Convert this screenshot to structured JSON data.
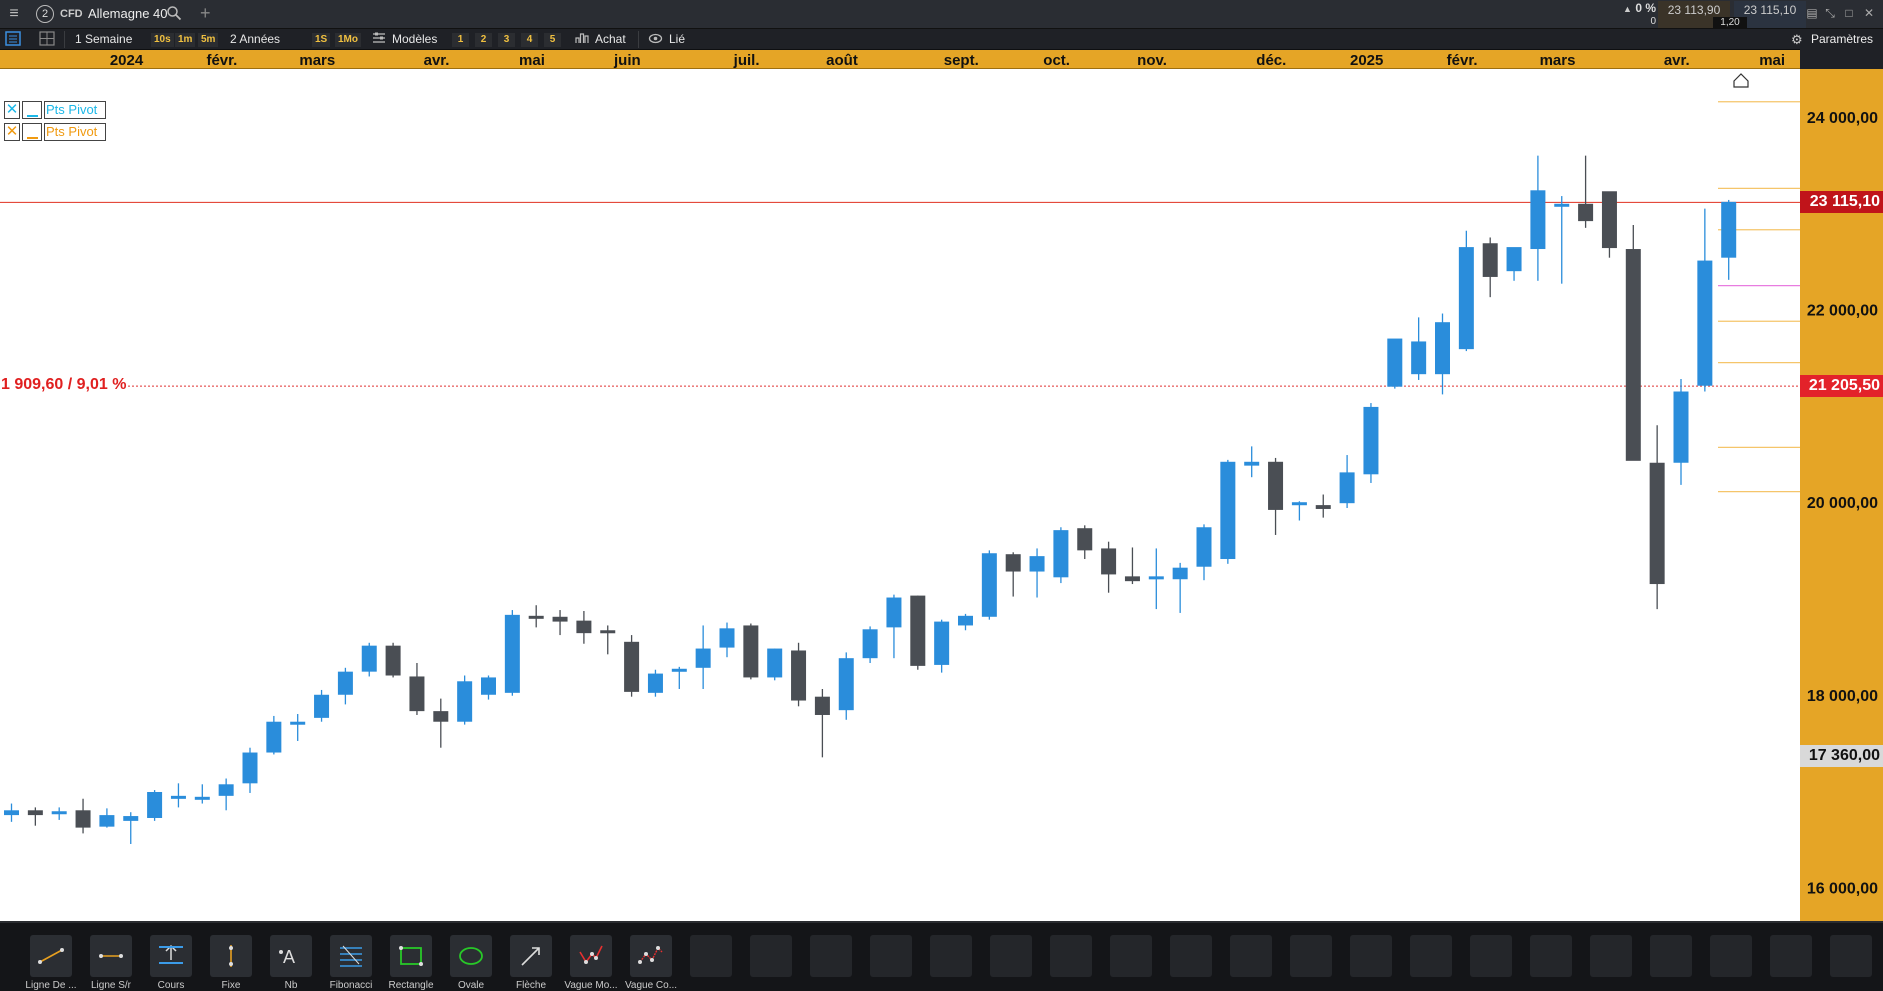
{
  "titlebar": {
    "instrument_number": "2",
    "type_badge": "CFD",
    "instrument": "Allemagne 40",
    "change_pct": "0 %",
    "change_abs": "0",
    "bid": "23 113,90",
    "ask": "23 115,10",
    "spread": "1,20"
  },
  "toolbar": {
    "period": "1 Semaine",
    "intervals": [
      "10s",
      "1m",
      "5m"
    ],
    "range": "2 Années",
    "ranges": [
      "1S",
      "1Mo"
    ],
    "templates": "Modèles",
    "presets": [
      "1",
      "2",
      "3",
      "4",
      "5"
    ],
    "buy": "Achat",
    "link": "Lié",
    "settings": "Paramètres"
  },
  "legend": [
    {
      "label": "Pts Pivot",
      "color": "#1cb8e8"
    },
    {
      "label": "Pts Pivot",
      "color": "#f09a10"
    }
  ],
  "measure_label": "1 909,60 / 9,01 %",
  "price_labels": {
    "current": "23 115,10",
    "reference": "21 205,50",
    "low": "17 360,00"
  },
  "colors": {
    "up": "#2a8ddb",
    "down": "#4a4e54",
    "time_axis": "#e5a526",
    "current_line": "#e03020",
    "pivot": "#f5c56a",
    "pivot_magenta": "#e87ce0"
  },
  "chart_data": {
    "type": "candlestick",
    "ylim": [
      15650,
      24500
    ],
    "y_ticks": [
      "16 000,00",
      "18 000,00",
      "20 000,00",
      "22 000,00",
      "24 000,00"
    ],
    "y_tick_values": [
      16000,
      18000,
      20000,
      22000,
      24000
    ],
    "x_ticks": [
      "2024",
      "févr.",
      "mars",
      "avr.",
      "mai",
      "juin",
      "juil.",
      "août",
      "sept.",
      "oct.",
      "nov.",
      "déc.",
      "2025",
      "févr.",
      "mars",
      "avr.",
      "mai"
    ],
    "x_tick_weeks": [
      0,
      4,
      8,
      13,
      17,
      21,
      26,
      30,
      35,
      39,
      43,
      48,
      52,
      56,
      60,
      65,
      69
    ],
    "current_price": 23115,
    "reference_price": 21205.5,
    "pivot_levels": [
      24160,
      23260,
      22830,
      21880,
      21450,
      20570,
      20110
    ],
    "candles": [
      [
        16750,
        16870,
        16680,
        16800
      ],
      [
        16800,
        16830,
        16640,
        16750
      ],
      [
        16760,
        16830,
        16700,
        16790
      ],
      [
        16800,
        16920,
        16560,
        16620
      ],
      [
        16630,
        16820,
        16620,
        16750
      ],
      [
        16690,
        16780,
        16450,
        16740
      ],
      [
        16720,
        17010,
        16690,
        16990
      ],
      [
        16920,
        17080,
        16830,
        16950
      ],
      [
        16920,
        17070,
        16870,
        16940
      ],
      [
        16950,
        17130,
        16800,
        17070
      ],
      [
        17080,
        17450,
        16980,
        17400
      ],
      [
        17400,
        17780,
        17380,
        17720
      ],
      [
        17700,
        17800,
        17520,
        17720
      ],
      [
        17760,
        18050,
        17720,
        18000
      ],
      [
        18000,
        18280,
        17900,
        18240
      ],
      [
        18240,
        18540,
        18190,
        18510
      ],
      [
        18510,
        18540,
        18180,
        18200
      ],
      [
        18190,
        18330,
        17790,
        17830
      ],
      [
        17830,
        17960,
        17450,
        17720
      ],
      [
        17720,
        18200,
        17690,
        18140
      ],
      [
        18000,
        18200,
        17950,
        18180
      ],
      [
        18020,
        18880,
        17990,
        18830
      ],
      [
        18820,
        18930,
        18700,
        18790
      ],
      [
        18810,
        18880,
        18620,
        18760
      ],
      [
        18770,
        18870,
        18530,
        18640
      ],
      [
        18670,
        18720,
        18420,
        18660
      ],
      [
        18550,
        18620,
        17980,
        18030
      ],
      [
        18020,
        18260,
        17980,
        18220
      ],
      [
        18240,
        18290,
        18060,
        18270
      ],
      [
        18280,
        18720,
        18060,
        18480
      ],
      [
        18490,
        18750,
        18390,
        18690
      ],
      [
        18720,
        18740,
        18160,
        18180
      ],
      [
        18180,
        18480,
        18150,
        18480
      ],
      [
        18460,
        18540,
        17880,
        17940
      ],
      [
        17980,
        18060,
        17350,
        17790
      ],
      [
        17840,
        18440,
        17740,
        18380
      ],
      [
        18380,
        18710,
        18330,
        18680
      ],
      [
        18700,
        19040,
        18380,
        19010
      ],
      [
        19030,
        19030,
        18260,
        18300
      ],
      [
        18310,
        18780,
        18230,
        18760
      ],
      [
        18720,
        18840,
        18670,
        18820
      ],
      [
        18810,
        19500,
        18780,
        19470
      ],
      [
        19460,
        19480,
        19020,
        19280
      ],
      [
        19280,
        19520,
        19010,
        19440
      ],
      [
        19220,
        19740,
        19160,
        19710
      ],
      [
        19730,
        19760,
        19410,
        19500
      ],
      [
        19520,
        19590,
        19060,
        19250
      ],
      [
        19230,
        19530,
        19150,
        19180
      ],
      [
        19200,
        19520,
        18890,
        19230
      ],
      [
        19200,
        19370,
        18850,
        19320
      ],
      [
        19330,
        19770,
        19190,
        19740
      ],
      [
        19410,
        20440,
        19360,
        20420
      ],
      [
        20380,
        20580,
        20260,
        20420
      ],
      [
        20420,
        20460,
        19660,
        19920
      ],
      [
        19970,
        20010,
        19810,
        20000
      ],
      [
        19970,
        20080,
        19840,
        19930
      ],
      [
        19990,
        20490,
        19940,
        20310
      ],
      [
        20290,
        21030,
        20200,
        20990
      ],
      [
        21200,
        21360,
        21180,
        21700
      ],
      [
        21330,
        21920,
        21270,
        21670
      ],
      [
        21330,
        21960,
        21120,
        21870
      ],
      [
        21590,
        22820,
        21570,
        22650
      ],
      [
        22690,
        22750,
        22130,
        22340
      ],
      [
        22400,
        22620,
        22300,
        22650
      ],
      [
        22630,
        23600,
        22300,
        23240
      ],
      [
        23100,
        23180,
        22270,
        23100
      ],
      [
        23100,
        23600,
        22850,
        22920
      ],
      [
        23230,
        23180,
        22540,
        22640
      ],
      [
        22630,
        22880,
        20510,
        20430
      ],
      [
        20410,
        20800,
        18890,
        19150
      ],
      [
        20410,
        21280,
        20180,
        21150
      ],
      [
        21210,
        23050,
        21150,
        22510
      ],
      [
        22540,
        23140,
        22310,
        23120
      ]
    ]
  },
  "tools": [
    {
      "label": "Ligne De ...",
      "icon": "trend-line-icon"
    },
    {
      "label": "Ligne S/r",
      "icon": "support-line-icon"
    },
    {
      "label": "Cours",
      "icon": "price-tool-icon"
    },
    {
      "label": "Fixe",
      "icon": "vertical-line-icon"
    },
    {
      "label": "Nb",
      "icon": "text-tool-icon"
    },
    {
      "label": "Fibonacci",
      "icon": "fibonacci-icon"
    },
    {
      "label": "Rectangle",
      "icon": "rectangle-icon"
    },
    {
      "label": "Ovale",
      "icon": "oval-icon"
    },
    {
      "label": "Flèche",
      "icon": "arrow-icon"
    },
    {
      "label": "Vague Mo...",
      "icon": "wave-icon"
    },
    {
      "label": "Vague Co...",
      "icon": "wave-correction-icon"
    }
  ]
}
